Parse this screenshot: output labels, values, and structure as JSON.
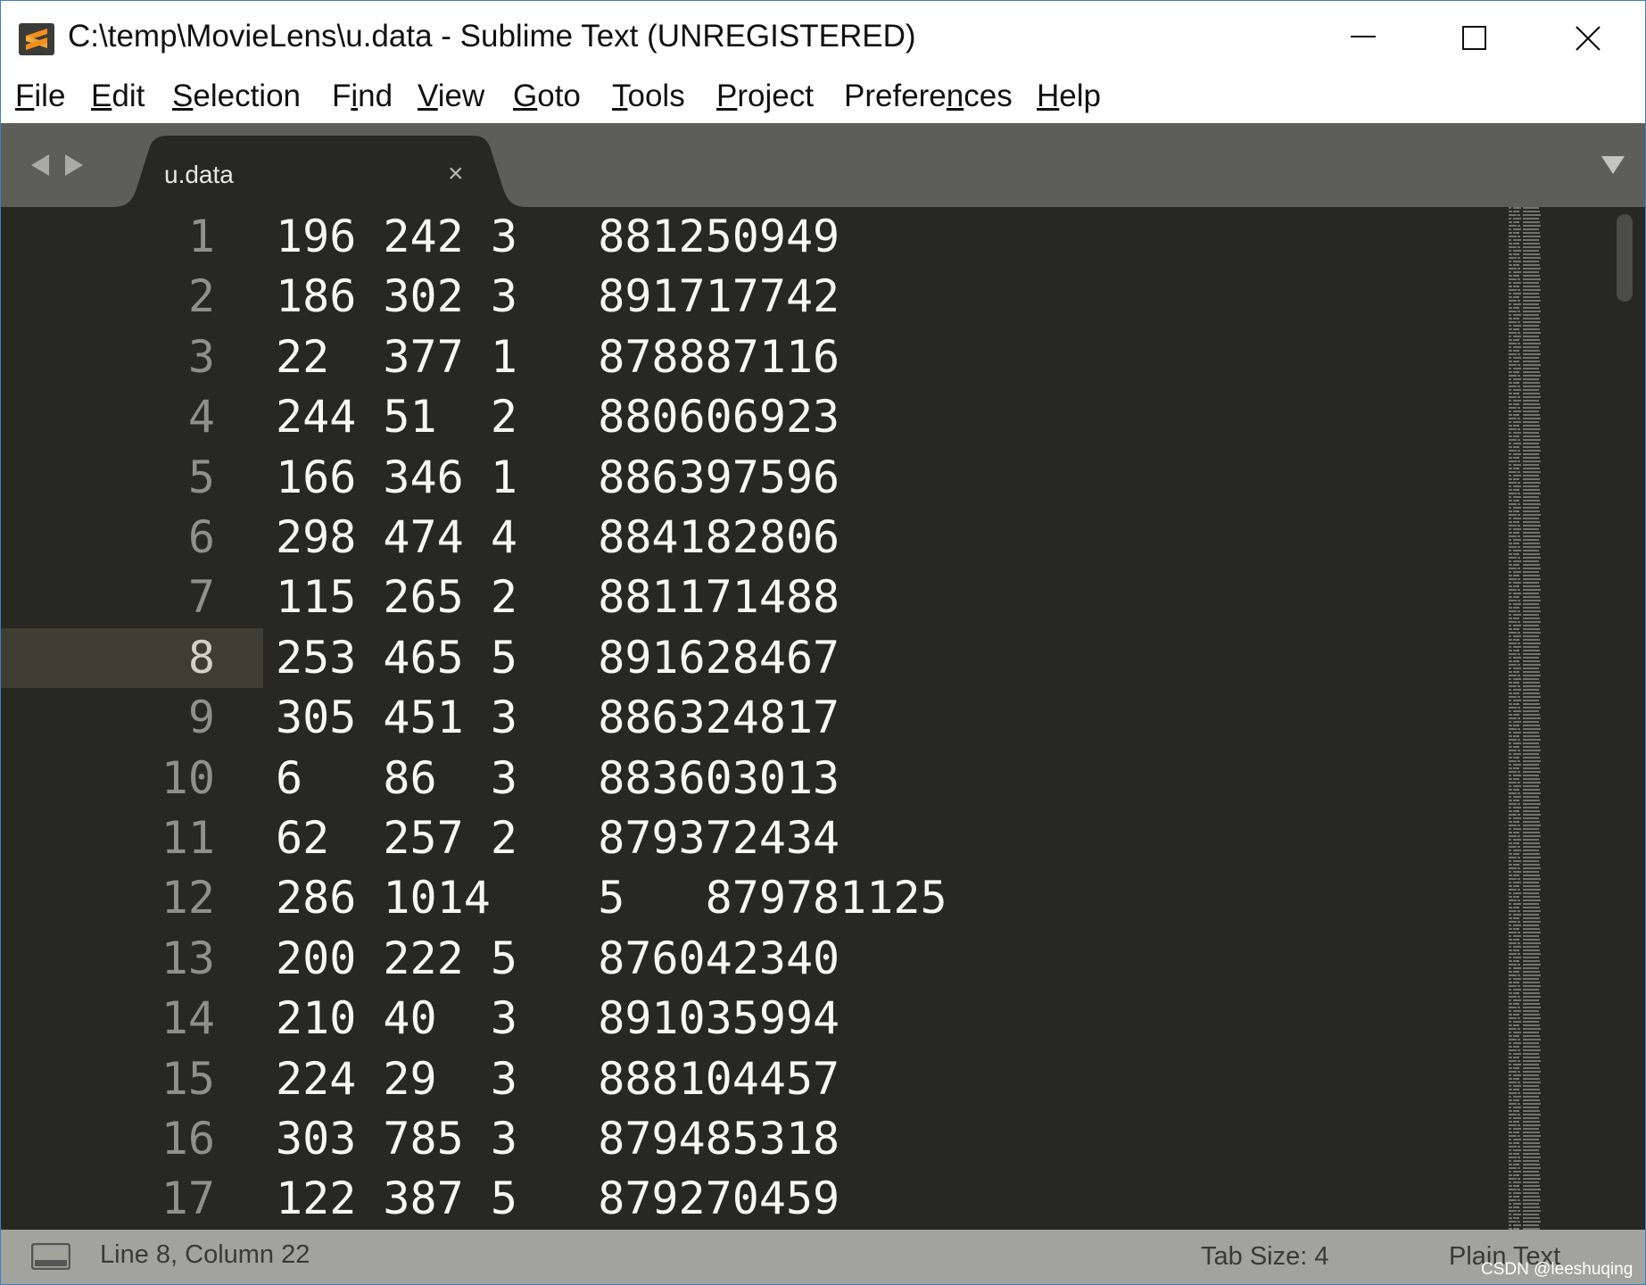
{
  "window": {
    "title": "C:\\temp\\MovieLens\\u.data - Sublime Text (UNREGISTERED)",
    "controls": {
      "minimize": "minimize-icon",
      "maximize": "maximize-icon",
      "close": "close-icon"
    }
  },
  "menu": [
    {
      "accel": "F",
      "rest": "ile"
    },
    {
      "accel": "E",
      "rest": "dit"
    },
    {
      "accel": "S",
      "rest": "election"
    },
    {
      "pre": "F",
      "accel": "i",
      "rest": "nd"
    },
    {
      "accel": "V",
      "rest": "iew"
    },
    {
      "accel": "G",
      "rest": "oto"
    },
    {
      "accel": "T",
      "rest": "ools"
    },
    {
      "accel": "P",
      "rest": "roject"
    },
    {
      "pre": "Prefere",
      "accel": "n",
      "rest": "ces"
    },
    {
      "accel": "H",
      "rest": "elp"
    }
  ],
  "tabs": [
    {
      "label": "u.data",
      "close": "×",
      "active": true
    }
  ],
  "editor": {
    "current_line": 8,
    "lines": [
      "196\t242\t3\t881250949",
      "186\t302\t3\t891717742",
      "22\t377\t1\t878887116",
      "244\t51\t2\t880606923",
      "166\t346\t1\t886397596",
      "298\t474\t4\t884182806",
      "115\t265\t2\t881171488",
      "253\t465\t5\t891628467",
      "305\t451\t3\t886324817",
      "6\t86\t3\t883603013",
      "62\t257\t2\t879372434",
      "286\t1014\t5\t879781125",
      "200\t222\t5\t876042340",
      "210\t40\t3\t891035994",
      "224\t29\t3\t888104457",
      "303\t785\t3\t879485318",
      "122\t387\t5\t879270459"
    ]
  },
  "status": {
    "position": "Line 8, Column 22",
    "tab_size": "Tab Size: 4",
    "syntax": "Plain Text"
  },
  "watermark": "CSDN @leeshuqing",
  "colors": {
    "editor_bg": "#272822",
    "text": "#f8f8f2",
    "gutter_text": "#90908a",
    "line_highlight": "#3e3d32",
    "tabbar_bg": "#5c5e57",
    "statusbar_bg": "#a2a39c",
    "icon_orange": "#f48f1b"
  }
}
